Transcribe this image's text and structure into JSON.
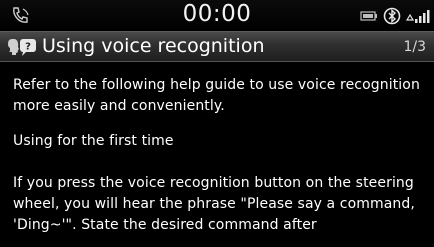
{
  "status_bar": {
    "clock": "00:00",
    "left_icon": "phone-signal-icon",
    "right_icons": [
      "battery-icon",
      "bluetooth-icon",
      "signal-bars-icon"
    ]
  },
  "title_bar": {
    "icon": "voice-recognition-icon",
    "title": "Using voice recognition",
    "page_indicator": "1/3"
  },
  "content": {
    "paragraph1": "Refer to the following help guide to use voice recognition more easily and conveniently.",
    "paragraph2": "Using for the first time",
    "paragraph3": "If you press the voice recognition button on the steering wheel, you will hear the phrase \"Please say a command, 'Ding~'\". State the desired command after"
  },
  "colors": {
    "background": "#000000",
    "title_bar": "#3a3a3a",
    "text": "#ffffff"
  }
}
